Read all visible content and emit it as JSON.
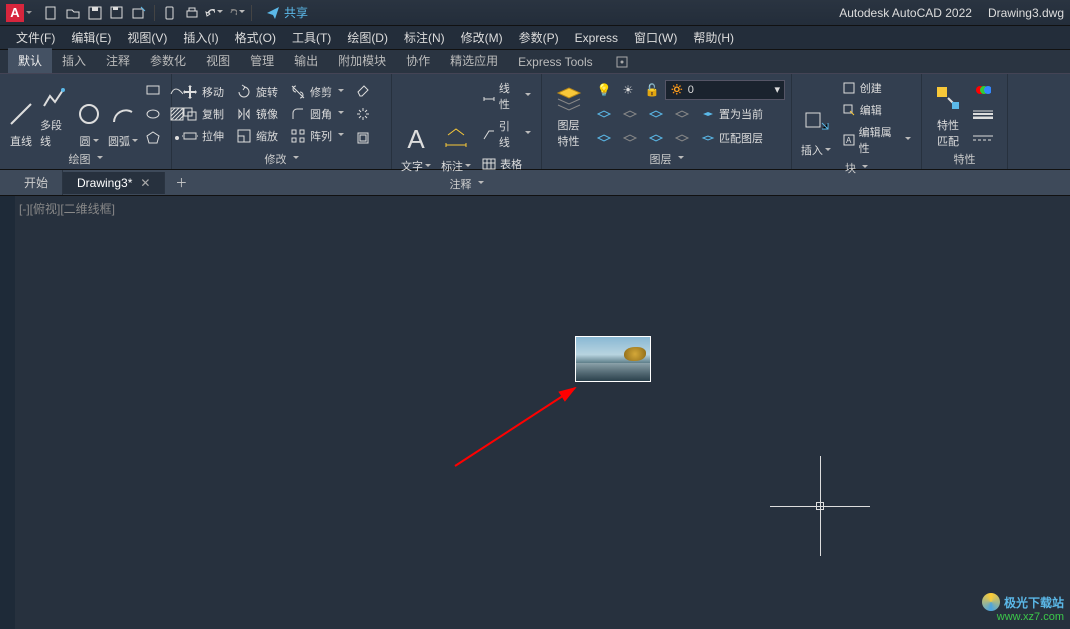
{
  "title": {
    "app": "Autodesk AutoCAD 2022",
    "file": "Drawing3.dwg"
  },
  "qat": {
    "share": "共享"
  },
  "menu": [
    "文件(F)",
    "编辑(E)",
    "视图(V)",
    "插入(I)",
    "格式(O)",
    "工具(T)",
    "绘图(D)",
    "标注(N)",
    "修改(M)",
    "参数(P)",
    "Express",
    "窗口(W)",
    "帮助(H)"
  ],
  "ribbonTabs": [
    "默认",
    "插入",
    "注释",
    "参数化",
    "视图",
    "管理",
    "输出",
    "附加模块",
    "协作",
    "精选应用",
    "Express Tools"
  ],
  "panels": {
    "draw": {
      "title": "绘图",
      "line": "直线",
      "polyline": "多段线",
      "circle": "圆",
      "arc": "圆弧"
    },
    "modify": {
      "title": "修改",
      "move": "移动",
      "rotate": "旋转",
      "trim": "修剪",
      "copy": "复制",
      "mirror": "镜像",
      "fillet": "圆角",
      "stretch": "拉伸",
      "scale": "缩放",
      "array": "阵列"
    },
    "annot": {
      "title": "注释",
      "text": "文字",
      "dim": "标注",
      "linear": "线性",
      "leader": "引线",
      "table": "表格"
    },
    "layer": {
      "title": "图层",
      "props": "图层\n特性",
      "current": "0",
      "setcur": "置为当前",
      "match": "匹配图层"
    },
    "block": {
      "title": "块",
      "insert": "插入",
      "create": "创建",
      "edit": "编辑",
      "attrib": "编辑属性"
    },
    "props": {
      "title": "特性",
      "match": "特性\n匹配"
    }
  },
  "docTabs": {
    "start": "开始",
    "drawing": "Drawing3*"
  },
  "viewport": {
    "label": "[-][俯视][二维线框]"
  },
  "watermark": {
    "t1": "极光下载站",
    "t2": "www.xz7.com"
  }
}
